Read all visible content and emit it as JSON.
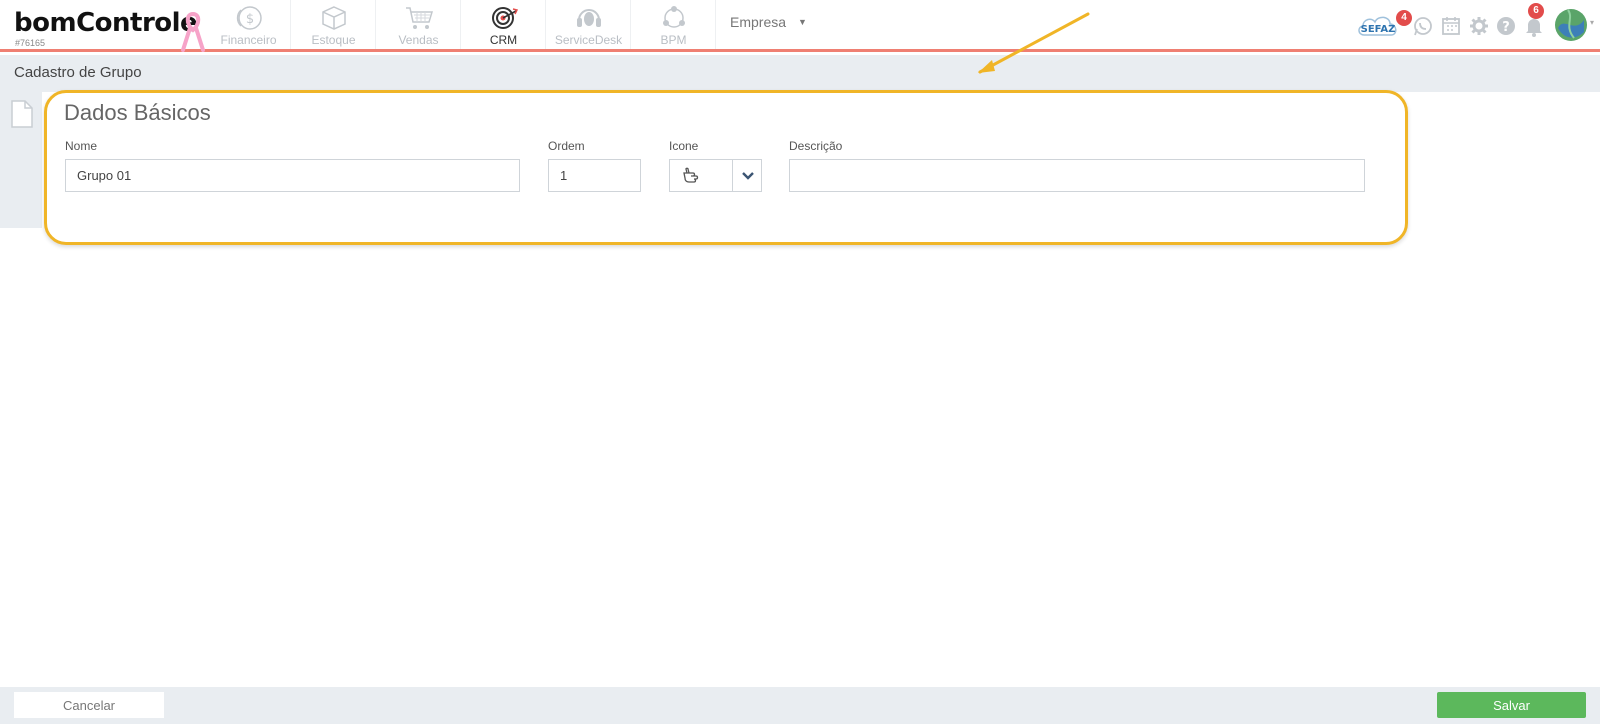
{
  "brand": {
    "logo_text": "bomControle",
    "account_id": "#76165"
  },
  "modules": [
    {
      "label": "Financeiro",
      "icon": "dollar-coin-icon",
      "active": false
    },
    {
      "label": "Estoque",
      "icon": "box-icon",
      "active": false
    },
    {
      "label": "Vendas",
      "icon": "shopping-cart-icon",
      "active": false
    },
    {
      "label": "CRM",
      "icon": "target-icon",
      "active": true
    },
    {
      "label": "ServiceDesk",
      "icon": "headset-icon",
      "active": false
    },
    {
      "label": "BPM",
      "icon": "process-cycle-icon",
      "active": false
    }
  ],
  "empresa": {
    "label": "Empresa"
  },
  "topbar_right": {
    "sefaz_label": "SEFAZ",
    "sefaz_badge": "4",
    "notifications_badge": "6"
  },
  "page": {
    "title": "Cadastro de Grupo"
  },
  "form": {
    "section_title": "Dados Básicos",
    "nome": {
      "label": "Nome",
      "value": "Grupo 01"
    },
    "ordem": {
      "label": "Ordem",
      "value": "1"
    },
    "icone": {
      "label": "Icone",
      "selected_icon": "hand-pointing-icon"
    },
    "descricao": {
      "label": "Descrição",
      "value": ""
    }
  },
  "footer": {
    "cancel_label": "Cancelar",
    "save_label": "Salvar"
  },
  "colors": {
    "accent_red": "#ef7f72",
    "highlight": "#f0b527",
    "save_green": "#5cb85c"
  }
}
